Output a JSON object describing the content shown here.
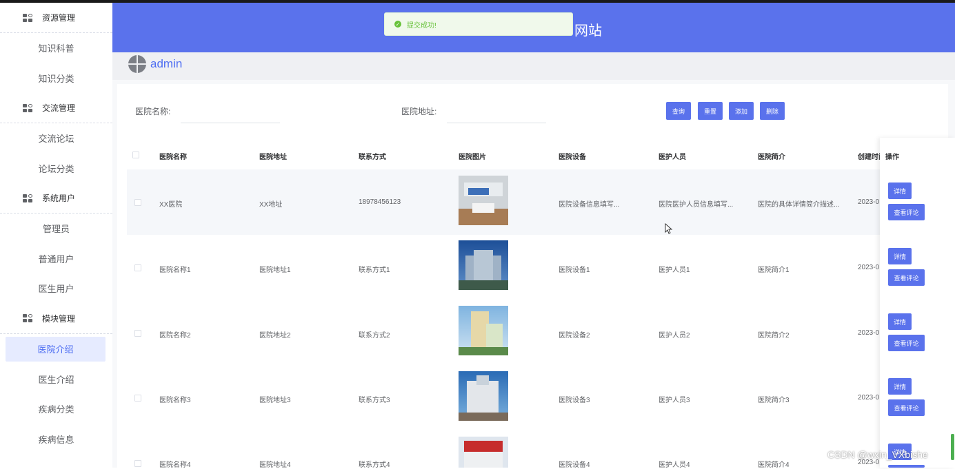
{
  "sidebar": {
    "groups": [
      {
        "label": "资源管理",
        "items": [
          "知识科普",
          "知识分类"
        ]
      },
      {
        "label": "交流管理",
        "items": [
          "交流论坛",
          "论坛分类"
        ]
      },
      {
        "label": "系统用户",
        "items": [
          "管理员",
          "普通用户",
          "医生用户"
        ]
      },
      {
        "label": "模块管理",
        "items": [
          "医院介绍",
          "医生介绍",
          "疾病分类",
          "疾病信息"
        ]
      }
    ],
    "active": "医院介绍"
  },
  "header": {
    "title": "网站"
  },
  "toast": {
    "text": "提交成功!"
  },
  "user": {
    "name": "admin"
  },
  "filter": {
    "name_label": "医院名称:",
    "address_label": "医院地址:",
    "buttons": {
      "query": "查询",
      "reset": "重置",
      "add": "添加",
      "delete": "删除"
    }
  },
  "table": {
    "headers": [
      "医院名称",
      "医院地址",
      "联系方式",
      "医院图片",
      "医院设备",
      "医护人员",
      "医院简介",
      "创建时间",
      "操作"
    ],
    "rows": [
      {
        "name": "XX医院",
        "address": "XX地址",
        "contact": "18978456123",
        "equipment": "医院设备信息填写...",
        "staff": "医院医护人员信息填写...",
        "intro": "医院的具体详情简介描述...",
        "created": "2023-0"
      },
      {
        "name": "医院名称1",
        "address": "医院地址1",
        "contact": "联系方式1",
        "equipment": "医院设备1",
        "staff": "医护人员1",
        "intro": "医院简介1",
        "created": "2023-0"
      },
      {
        "name": "医院名称2",
        "address": "医院地址2",
        "contact": "联系方式2",
        "equipment": "医院设备2",
        "staff": "医护人员2",
        "intro": "医院简介2",
        "created": "2023-0"
      },
      {
        "name": "医院名称3",
        "address": "医院地址3",
        "contact": "联系方式3",
        "equipment": "医院设备3",
        "staff": "医护人员3",
        "intro": "医院简介3",
        "created": "2023-0"
      },
      {
        "name": "医院名称4",
        "address": "医院地址4",
        "contact": "联系方式4",
        "equipment": "医院设备4",
        "staff": "医护人员4",
        "intro": "医院简介4",
        "created": "2023-0"
      }
    ],
    "row_actions": {
      "detail": "详情",
      "comments": "查看评论"
    }
  },
  "watermark": "CSDN @wxin_VXbishe",
  "colors": {
    "primary": "#5a72ec",
    "success": "#67c23a",
    "active_bg": "#e6ebff"
  }
}
